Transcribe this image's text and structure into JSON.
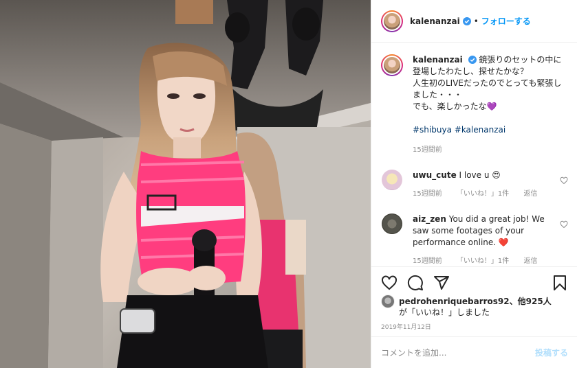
{
  "header": {
    "username": "kalenanzai",
    "separator": "•",
    "follow_label": "フォローする"
  },
  "caption": {
    "username": "kalenanzai",
    "lines": [
      "鏡張りのセットの中に登場したわたし、探せたかな？",
      "人生初のLIVEだったのでとっても緊張しました・・・",
      "でも、楽しかったな💜"
    ],
    "hashtags": [
      "#shibuya",
      "#kalenanzai"
    ],
    "time": "15週間前"
  },
  "comments": [
    {
      "username": "uwu_cute",
      "text": "I love u 😍",
      "time": "15週間前",
      "likes": "「いいね！」1件",
      "reply": "返信"
    },
    {
      "username": "aiz_zen",
      "text": "You did a great job! We saw some footages of your performance online. ❤️",
      "time": "15週間前",
      "likes": "「いいね！」1件",
      "reply": "返信"
    }
  ],
  "likes": {
    "user": "pedrohenriquebarros92",
    "rest": "、他925人",
    "line2": "が「いいね！」しました"
  },
  "date": "2019年11月12日",
  "add_comment": {
    "placeholder": "コメントを追加...",
    "post_label": "投稿する"
  },
  "colors": {
    "accent": "#0095f6",
    "text": "#262626",
    "muted": "#8e8e8e",
    "hashtag": "#00376b",
    "heart_red": "#ed4956",
    "top_pink": "#ff3d7f"
  },
  "icons": [
    "verified-icon",
    "heart-icon",
    "comment-icon",
    "share-icon",
    "bookmark-icon",
    "small-heart-icon"
  ]
}
